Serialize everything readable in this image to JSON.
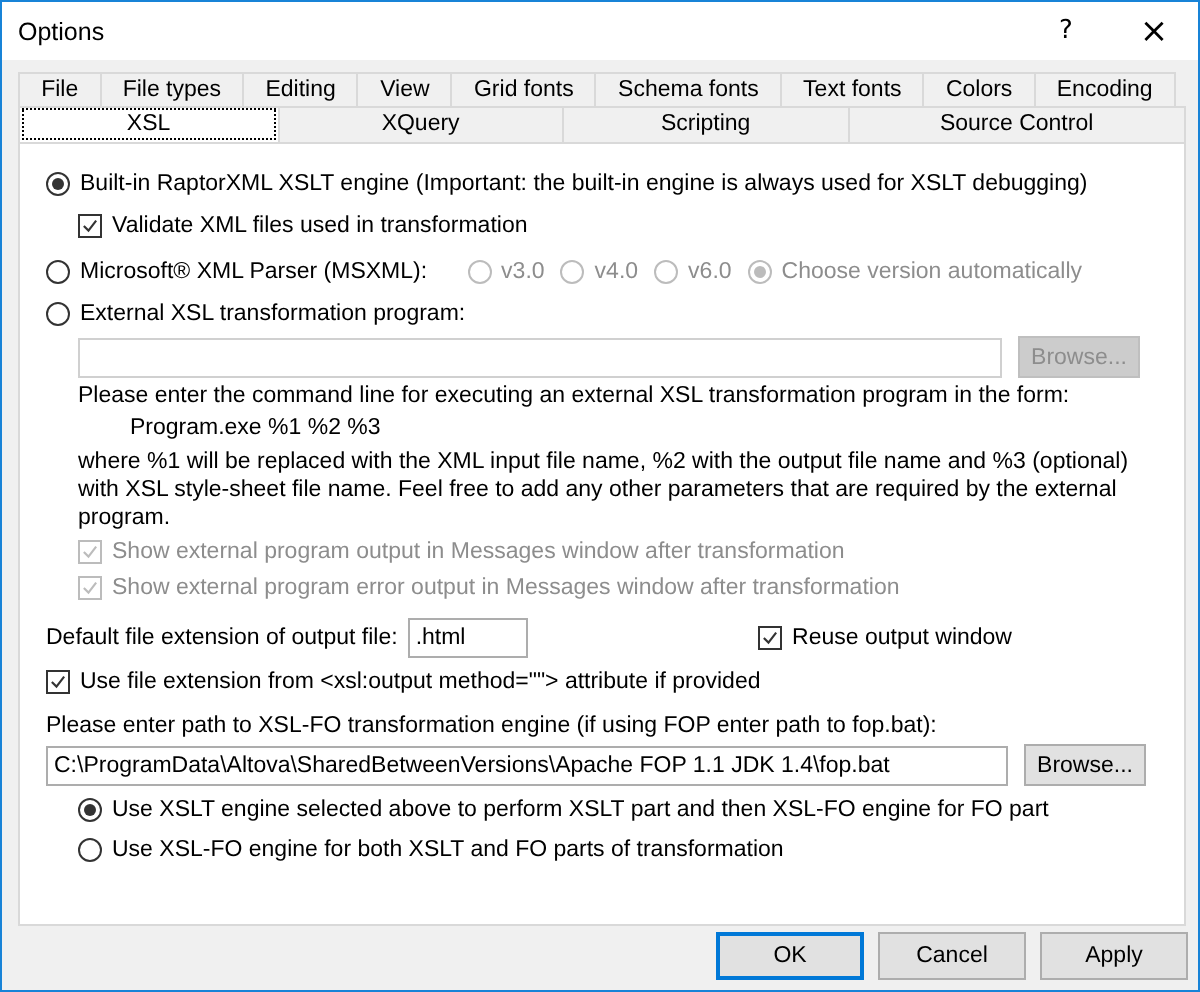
{
  "window": {
    "title": "Options",
    "help_button": "?",
    "close_button": "×"
  },
  "tab_rows": [
    [
      {
        "label": "File",
        "selected": false
      },
      {
        "label": "File types",
        "selected": false
      },
      {
        "label": "Editing",
        "selected": false
      },
      {
        "label": "View",
        "selected": false
      },
      {
        "label": "Grid fonts",
        "selected": false
      },
      {
        "label": "Schema fonts",
        "selected": false
      },
      {
        "label": "Text fonts",
        "selected": false
      },
      {
        "label": "Colors",
        "selected": false
      },
      {
        "label": "Encoding",
        "selected": false
      }
    ],
    [
      {
        "label": "XSL",
        "selected": true
      },
      {
        "label": "XQuery",
        "selected": false
      },
      {
        "label": "Scripting",
        "selected": false
      },
      {
        "label": "Source Control",
        "selected": false
      }
    ]
  ],
  "builtin": {
    "label": "Built-in RaptorXML XSLT engine (Important: the built-in engine is always used for XSLT debugging)",
    "selected": true,
    "validate": {
      "label": "Validate XML files used in transformation",
      "checked": true,
      "disabled": false
    }
  },
  "msxml": {
    "label": "Microsoft® XML Parser (MSXML):",
    "selected": false,
    "versions": [
      {
        "label": "v3.0",
        "selected": false,
        "disabled": true
      },
      {
        "label": "v4.0",
        "selected": false,
        "disabled": true
      },
      {
        "label": "v6.0",
        "selected": false,
        "disabled": true
      },
      {
        "label": "Choose version automatically",
        "selected": true,
        "disabled": true
      }
    ]
  },
  "external": {
    "label": "External XSL transformation program:",
    "selected": false,
    "browse": {
      "label": "Browse...",
      "disabled": true
    },
    "help_text": "Please enter the command line for executing an external XSL transformation program in the form:",
    "example": "Program.exe %1 %2 %3",
    "explanation": "where %1 will be replaced with the XML input file name, %2 with the output file name and %3 (optional) with XSL style-sheet  file name. Feel free to add any other parameters that are required by the external program.",
    "options": [
      {
        "label": "Show external program output in Messages window after transformation",
        "checked": true,
        "disabled": true
      },
      {
        "label": "Show external program error output in Messages window after transformation",
        "checked": true,
        "disabled": true
      }
    ]
  },
  "output": {
    "extension_label": "Default file extension of output file:",
    "extension_value": ".html",
    "reuse": {
      "label": "Reuse output window",
      "checked": true,
      "disabled": false
    },
    "use_extension": {
      "label": "Use file extension from <xsl:output method=\"\"> attribute if provided",
      "checked": true,
      "disabled": false
    }
  },
  "fo": {
    "label": "Please enter path to XSL-FO transformation engine (if using FOP enter path to fop.bat):",
    "path": "C:\\ProgramData\\Altova\\SharedBetweenVersions\\Apache FOP 1.1 JDK 1.4\\fop.bat",
    "browse": {
      "label": "Browse...",
      "disabled": false
    },
    "modes": [
      {
        "label": "Use XSLT engine selected above to perform XSLT part and then XSL-FO engine for FO part",
        "selected": true
      },
      {
        "label": "Use XSL-FO engine for both XSLT and FO parts of transformation",
        "selected": false
      }
    ]
  },
  "buttons": [
    {
      "label": "OK",
      "default": true
    },
    {
      "label": "Cancel",
      "default": false
    },
    {
      "label": "Apply",
      "default": false
    }
  ]
}
